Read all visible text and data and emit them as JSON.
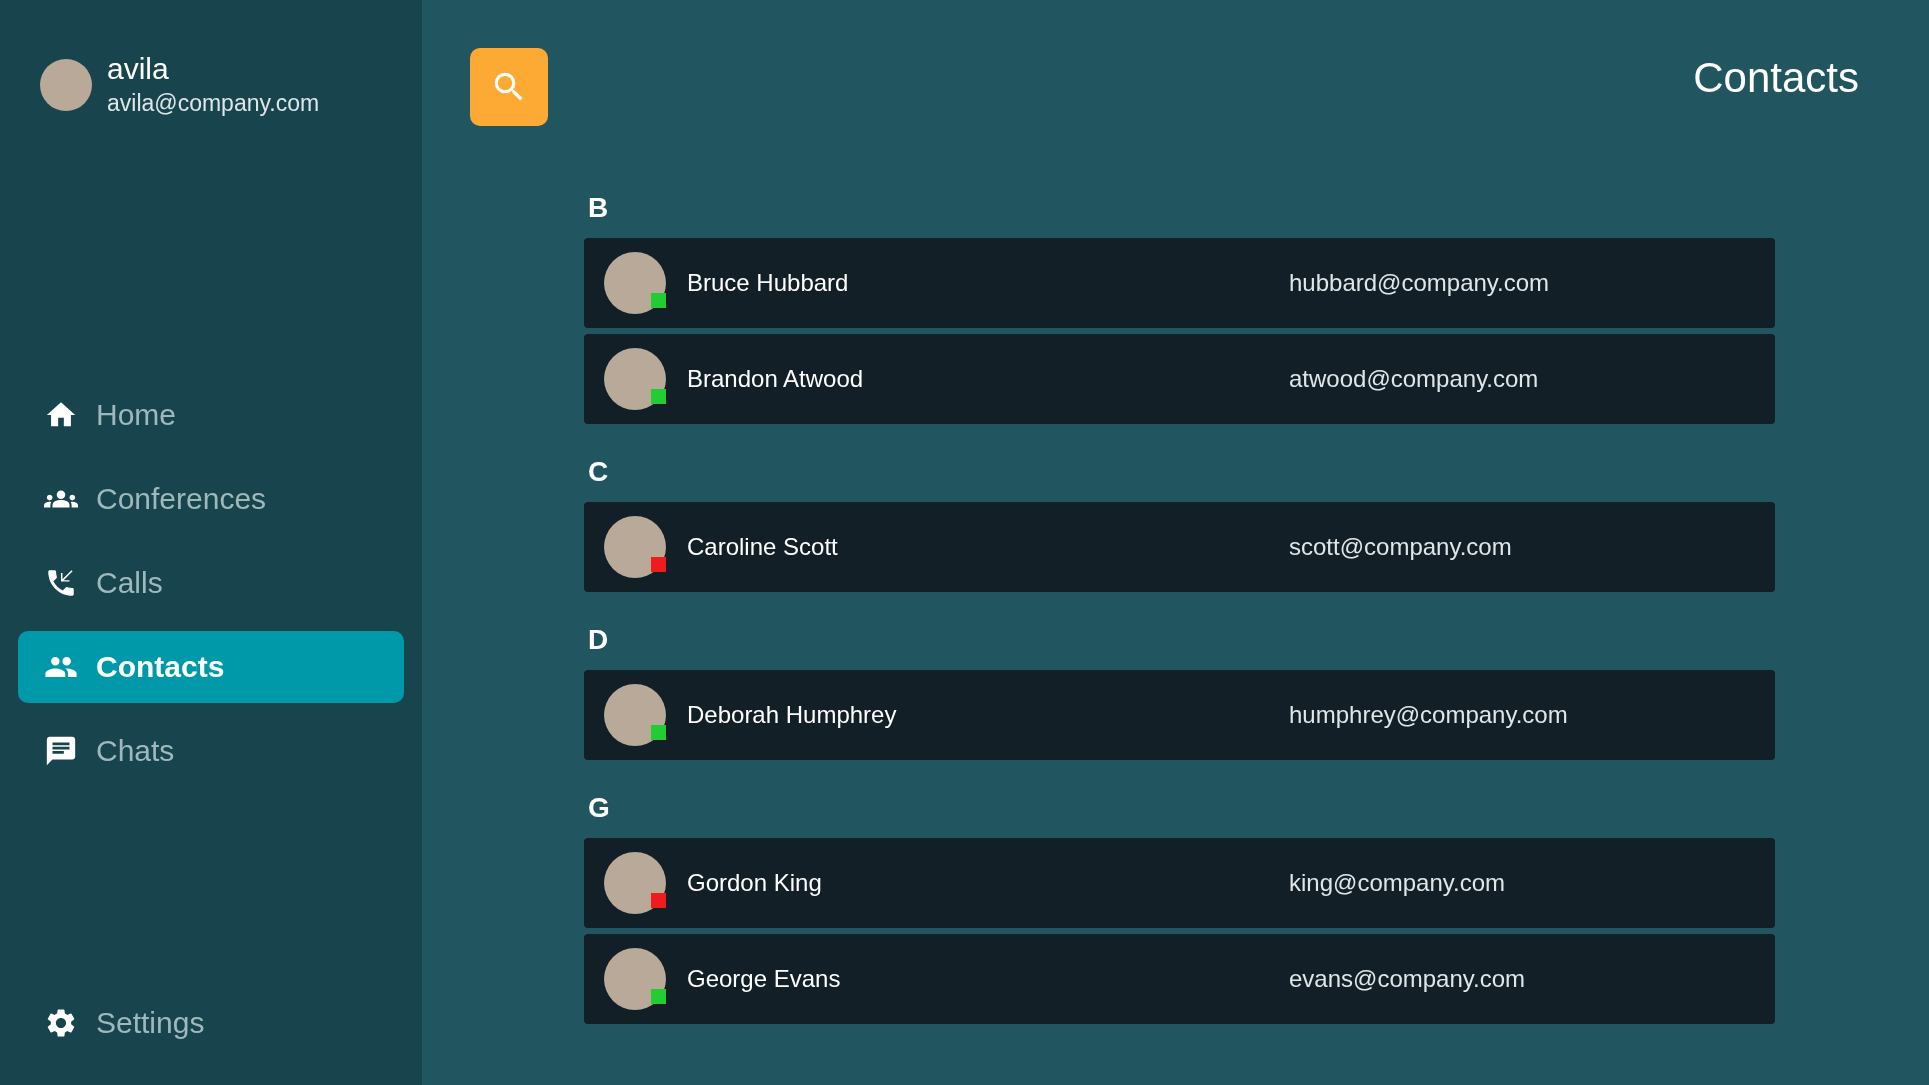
{
  "user": {
    "name": "avila",
    "email": "avila@company.com"
  },
  "sidebar": {
    "items": [
      {
        "label": "Home",
        "selected": false
      },
      {
        "label": "Conferences",
        "selected": false
      },
      {
        "label": "Calls",
        "selected": false
      },
      {
        "label": "Contacts",
        "selected": true
      },
      {
        "label": "Chats",
        "selected": false
      }
    ],
    "settings": {
      "label": "Settings"
    }
  },
  "page_title": "Contacts",
  "groups": [
    {
      "letter": "B",
      "contacts": [
        {
          "name": "Bruce Hubbard",
          "email": "hubbard@company.com",
          "color": "#22cc33"
        },
        {
          "name": "Brandon Atwood",
          "email": "atwood@company.com",
          "color": "#22cc33"
        }
      ]
    },
    {
      "letter": "C",
      "contacts": [
        {
          "name": "Caroline Scott",
          "email": "scott@company.com",
          "color": "#ee1c1c"
        }
      ]
    },
    {
      "letter": "D",
      "contacts": [
        {
          "name": "Deborah Humphrey",
          "email": "humphrey@company.com",
          "color": "#22cc33"
        }
      ]
    },
    {
      "letter": "G",
      "contacts": [
        {
          "name": "Gordon King",
          "email": "king@company.com",
          "color": "#ee1c1c"
        },
        {
          "name": "George Evans",
          "email": "evans@company.com",
          "color": "#22cc33"
        }
      ]
    }
  ]
}
